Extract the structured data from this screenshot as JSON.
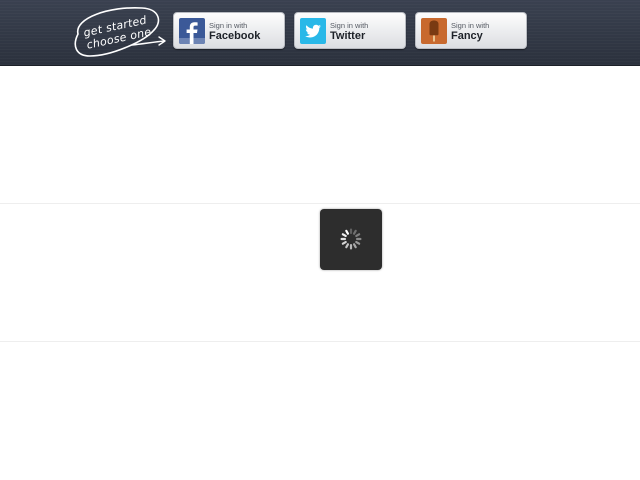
{
  "header": {
    "tagline": {
      "line1": "get started",
      "line2": "choose one"
    },
    "signin_buttons": [
      {
        "prefix": "Sign in with",
        "service": "Facebook",
        "icon": "facebook-icon",
        "color": "#3b5998"
      },
      {
        "prefix": "Sign in with",
        "service": "Twitter",
        "icon": "twitter-bird-icon",
        "color": "#29b8e8"
      },
      {
        "prefix": "Sign in with",
        "service": "Fancy",
        "icon": "fancy-popsicle-icon",
        "color": "#c8692e"
      }
    ]
  },
  "loading": {
    "icon": "spinner-icon",
    "background": "#2d2d2d"
  }
}
